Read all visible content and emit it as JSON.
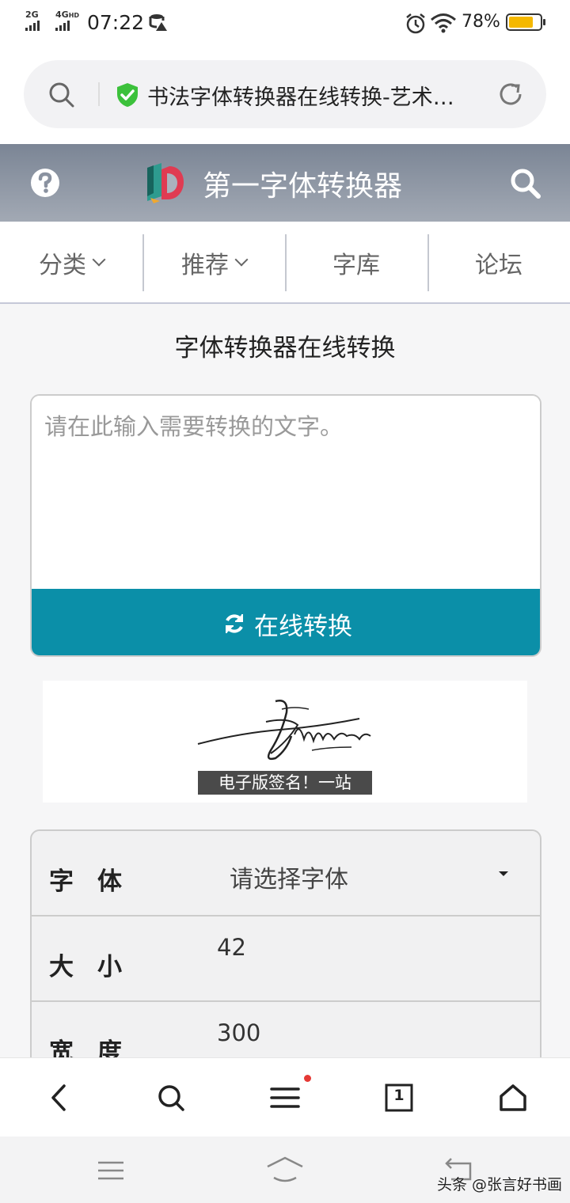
{
  "status_bar": {
    "sig1": "2G",
    "sig2": "4G",
    "sig2_suffix": "HD",
    "time": "07:22",
    "battery_pct": "78%",
    "battery_level": 0.78,
    "battery_color": "#f5b800"
  },
  "url_bar": {
    "title": "书法字体转换器在线转换-艺术签名设计",
    "secure_color": "#3cc13b"
  },
  "header": {
    "title": "第一字体转换器"
  },
  "nav": {
    "items": [
      {
        "label": "分类"
      },
      {
        "label": "推荐"
      },
      {
        "label": "字库"
      },
      {
        "label": "论坛"
      }
    ]
  },
  "main": {
    "title": "字体转换器在线转换",
    "input_placeholder": "请在此输入需要转换的文字。",
    "input_value": "",
    "convert_label": "在线转换",
    "accent_color": "#0b8fa8"
  },
  "ad": {
    "caption": "电子版签名！一站"
  },
  "options": {
    "font_label": "字体",
    "font_select": "请选择字体",
    "size_label": "大小",
    "size_value": "42",
    "width_label": "宽度",
    "width_value": "300"
  },
  "toolbar": {
    "tabs_count": "1"
  },
  "watermark": "头条 @张言好书画"
}
